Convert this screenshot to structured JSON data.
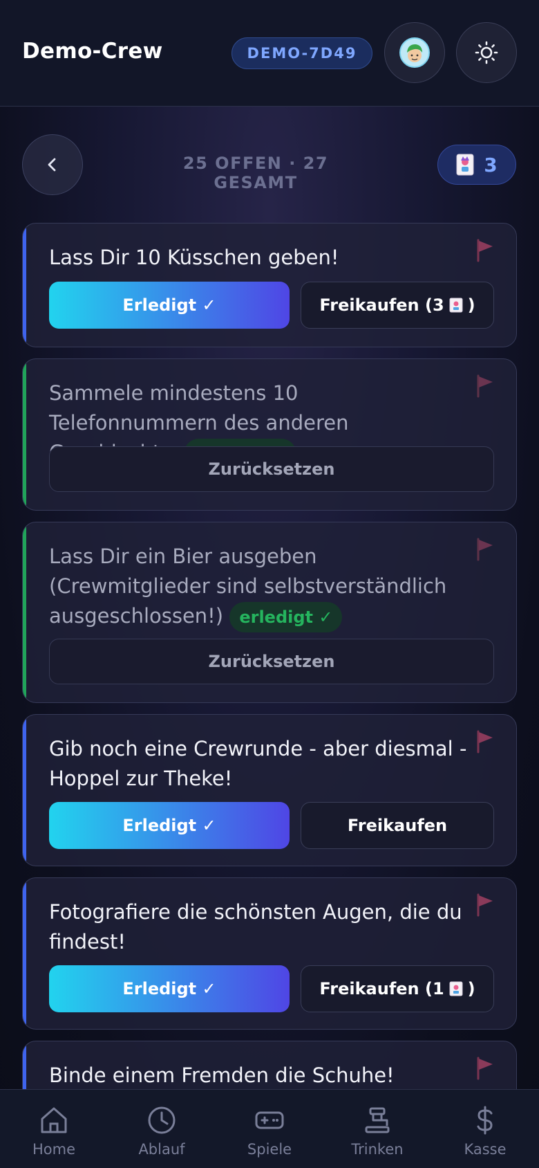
{
  "header": {
    "title": "Demo-Crew",
    "room_code": "DEMO-7D49",
    "avatar_icon": "avatar-icon",
    "theme_icon": "sun-icon"
  },
  "summary": {
    "counts_text": "25 OFFEN · 27 GESAMT",
    "token_count": "3"
  },
  "tasks": [
    {
      "text": "Lass Dir 10 Küsschen geben!",
      "status": "open",
      "primary": "Erledigt ✓",
      "secondary": "Freikaufen (3",
      "secondary_suffix": ")"
    },
    {
      "text": "Sammele mindestens 10 Telefonnummern des anderen Geschlechts.",
      "status": "done",
      "badge": "erledigt ✓",
      "reset": "Zurücksetzen"
    },
    {
      "text": "Lass Dir ein Bier ausgeben (Crewmitglieder sind selbstverständlich ausgeschlossen!)",
      "status": "done",
      "badge": "erledigt ✓",
      "reset": "Zurücksetzen"
    },
    {
      "text": "Gib noch eine Crewrunde - aber diesmal - Hoppel zur Theke!",
      "status": "open",
      "primary": "Erledigt ✓",
      "secondary": "Freikaufen"
    },
    {
      "text": "Fotografiere die schönsten Augen, die du findest!",
      "status": "open",
      "primary": "Erledigt ✓",
      "secondary": "Freikaufen (1",
      "secondary_suffix": ")"
    },
    {
      "text": "Binde einem Fremden die Schuhe!",
      "status": "open"
    }
  ],
  "nav": [
    {
      "label": "Home",
      "icon": "home-icon"
    },
    {
      "label": "Ablauf",
      "icon": "clock-icon"
    },
    {
      "label": "Spiele",
      "icon": "gamepad-icon"
    },
    {
      "label": "Trinken",
      "icon": "tap-icon"
    },
    {
      "label": "Kasse",
      "icon": "dollar-icon"
    }
  ],
  "colors": {
    "accent_open": "#3f64ee",
    "accent_done": "#21a45a",
    "gradient_start": "#22d3ee",
    "gradient_end": "#4f46e5",
    "room_code": "#7fa7ff"
  }
}
